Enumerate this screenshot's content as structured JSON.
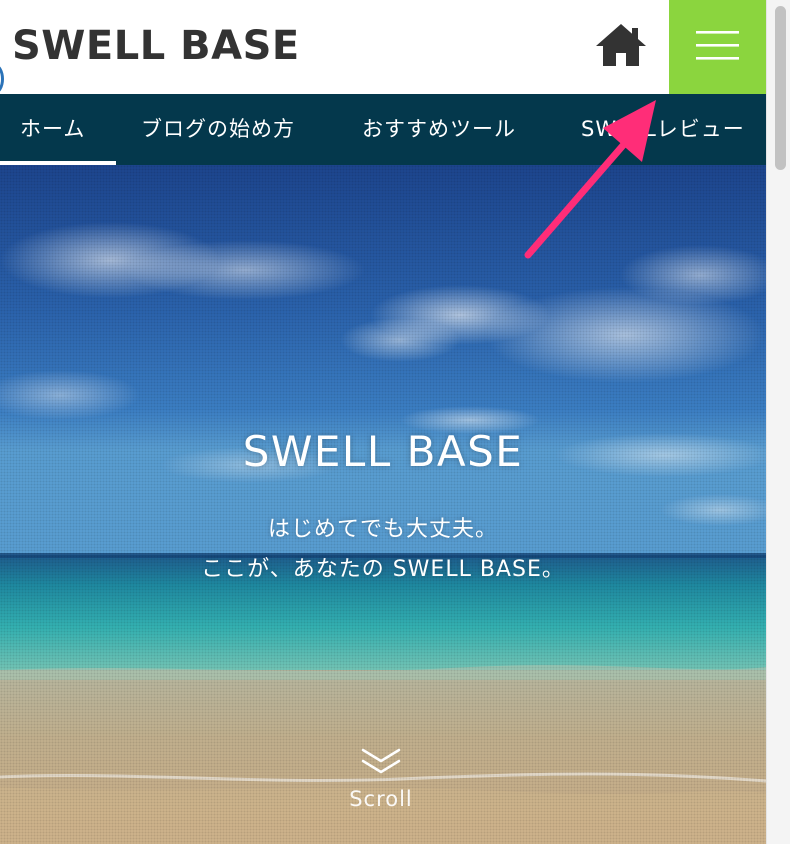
{
  "header": {
    "site_title": "SWELL BASE",
    "menu_button_color": "#8bd53e",
    "home_icon": "home-icon",
    "menu_icon": "hamburger-menu-icon"
  },
  "nav": {
    "background": "#04384c",
    "items": [
      {
        "label": "ホーム",
        "active": true
      },
      {
        "label": "ブログの始め方",
        "active": false
      },
      {
        "label": "おすすめツール",
        "active": false
      },
      {
        "label": "SWELLレビュー",
        "active": false
      }
    ]
  },
  "hero": {
    "title": "SWELL BASE",
    "subtitle_line1": "はじめてでも大丈夫。",
    "subtitle_line2": "ここが、あなたの SWELL BASE。",
    "scroll_label": "Scroll",
    "scroll_icon": "double-chevron-down-icon"
  },
  "annotation": {
    "arrow_color": "#ff2d78",
    "icon": "pointer-arrow-icon"
  }
}
